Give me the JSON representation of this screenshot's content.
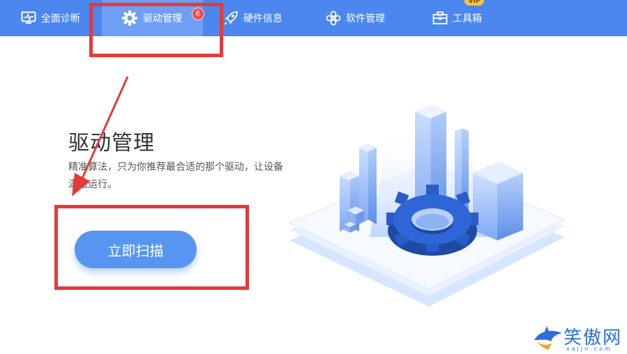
{
  "nav": {
    "tabs": [
      {
        "label": "全面诊断",
        "icon": "monitor-pulse-icon"
      },
      {
        "label": "驱动管理",
        "icon": "gear-icon",
        "active": true,
        "badge": "6"
      },
      {
        "label": "硬件信息",
        "icon": "rocket-icon"
      },
      {
        "label": "软件管理",
        "icon": "flower-icon"
      },
      {
        "label": "工具箱",
        "icon": "toolbox-icon"
      }
    ],
    "vip_label": "VIP"
  },
  "main": {
    "title": "驱动管理",
    "description": "精准算法，只为你推荐最合适的那个驱动，让设备满血运行。",
    "scan_button": "立即扫描"
  },
  "watermark": {
    "text": "笑傲网",
    "sub": "xajjn.com"
  },
  "colors": {
    "topbar": "#4b87ee",
    "active_tab": "#6d9ff4",
    "button": "#5796f0",
    "annotation": "#e53a3a"
  }
}
